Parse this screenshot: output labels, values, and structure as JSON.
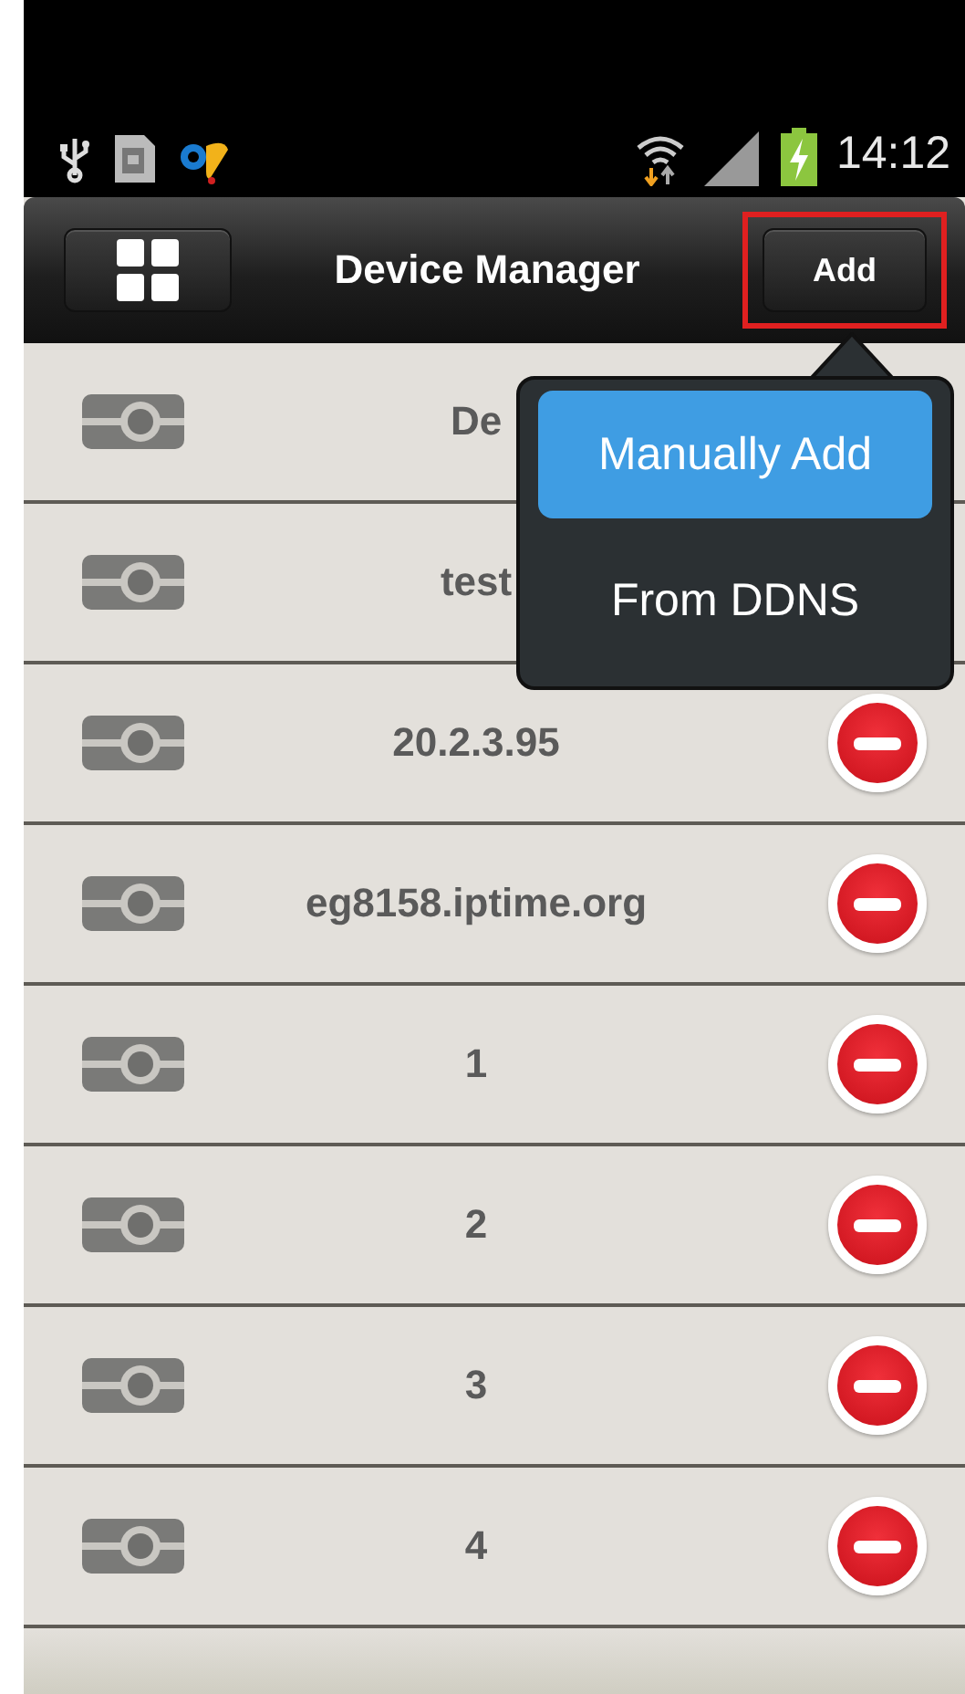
{
  "status_bar": {
    "time": "14:12"
  },
  "header": {
    "title": "Device Manager",
    "add_button": {
      "label": "Add",
      "highlighted": true
    }
  },
  "devices": [
    {
      "name": "De",
      "delete_visible": false
    },
    {
      "name": "test",
      "delete_visible": false
    },
    {
      "name": "20.2.3.95",
      "delete_visible": true
    },
    {
      "name": "eg8158.iptime.org",
      "delete_visible": true
    },
    {
      "name": "1",
      "delete_visible": true
    },
    {
      "name": "2",
      "delete_visible": true
    },
    {
      "name": "3",
      "delete_visible": true
    },
    {
      "name": "4",
      "delete_visible": true
    }
  ],
  "add_menu": {
    "items": [
      {
        "label": "Manually Add",
        "selected": true
      },
      {
        "label": "From DDNS",
        "selected": false
      }
    ]
  }
}
